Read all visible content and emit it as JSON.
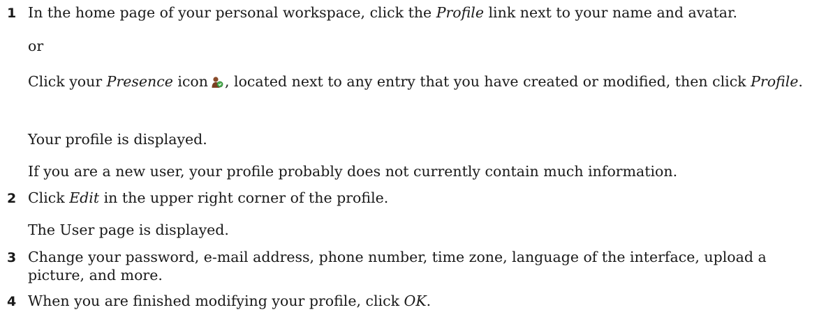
{
  "steps": [
    {
      "number": "1",
      "main": {
        "pre": "In the home page of your personal workspace, click the ",
        "em": "Profile",
        "post": " link next to your name and avatar."
      },
      "or": "or",
      "alt": {
        "pre": "Click your ",
        "em1": "Presence",
        "mid": " icon",
        "post": ", located next to any entry that you have created or modified, then click ",
        "em2": "Profile",
        "end": "."
      },
      "result": "Your profile is displayed.",
      "note": "If you are a new user, your profile probably does not currently contain much information."
    },
    {
      "number": "2",
      "main": {
        "pre": "Click ",
        "em": "Edit",
        "post": " in the upper right corner of the profile."
      },
      "result": "The User page is displayed."
    },
    {
      "number": "3",
      "main": {
        "text": "Change your password, e-mail address, phone number, time zone, language of the interface, upload a picture, and more."
      }
    },
    {
      "number": "4",
      "main": {
        "pre": "When you are finished modifying your profile, click ",
        "em": "OK",
        "post": "."
      }
    }
  ],
  "icons": {
    "presence": "presence-icon"
  }
}
